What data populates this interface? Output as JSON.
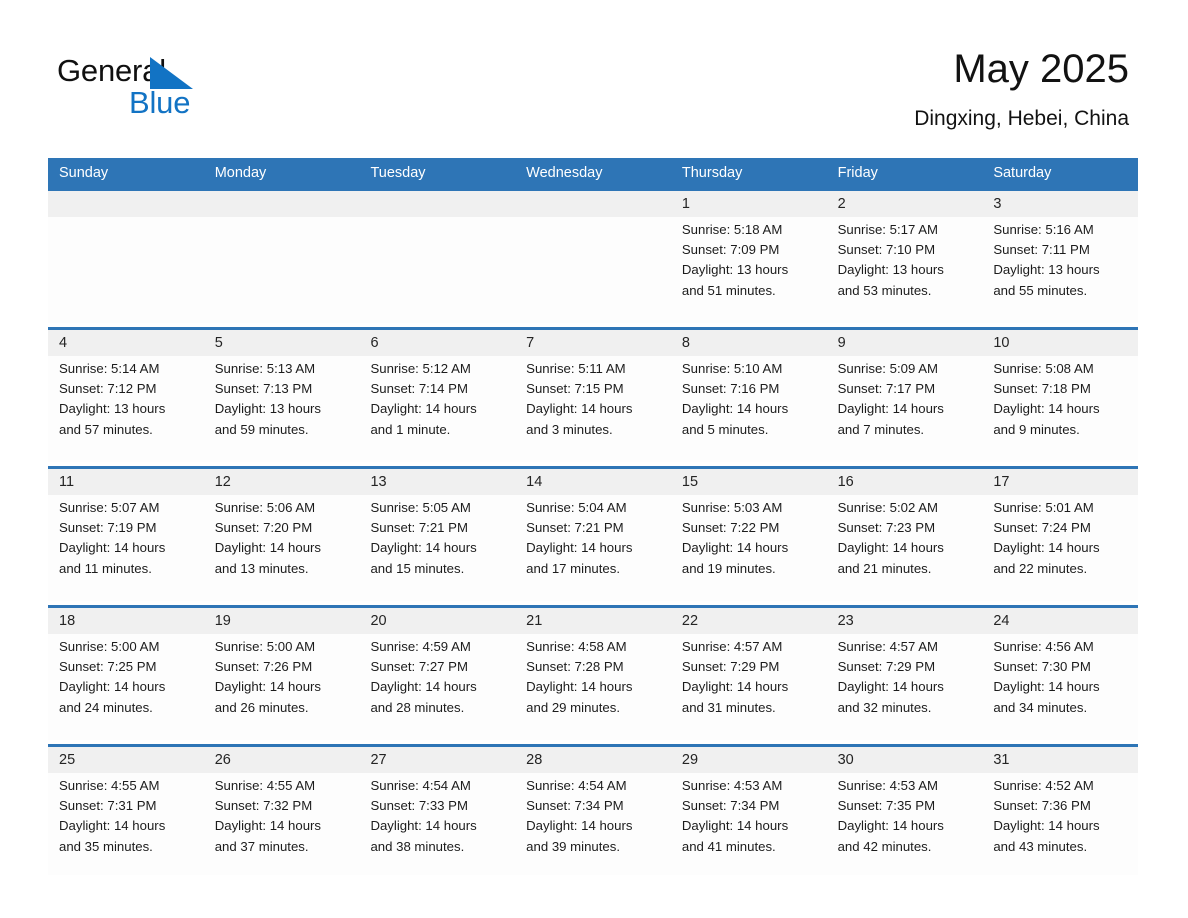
{
  "brand": {
    "name_part1": "General",
    "name_part2": "Blue",
    "triangle_color": "#1273c4",
    "text_color": "#101010"
  },
  "header": {
    "title": "May 2025",
    "subtitle": "Dingxing, Hebei, China"
  },
  "colors": {
    "header_blue": "#2e75b6",
    "date_band_gray": "#f0f0f0",
    "cell_white": "#fdfdfd",
    "text": "#1c1c1c"
  },
  "weekday_headers": [
    "Sunday",
    "Monday",
    "Tuesday",
    "Wednesday",
    "Thursday",
    "Friday",
    "Saturday"
  ],
  "weeks": [
    {
      "days": [
        {
          "num": "",
          "sunrise": "",
          "sunset": "",
          "daylight1": "",
          "daylight2": ""
        },
        {
          "num": "",
          "sunrise": "",
          "sunset": "",
          "daylight1": "",
          "daylight2": ""
        },
        {
          "num": "",
          "sunrise": "",
          "sunset": "",
          "daylight1": "",
          "daylight2": ""
        },
        {
          "num": "",
          "sunrise": "",
          "sunset": "",
          "daylight1": "",
          "daylight2": ""
        },
        {
          "num": "1",
          "sunrise": "Sunrise: 5:18 AM",
          "sunset": "Sunset: 7:09 PM",
          "daylight1": "Daylight: 13 hours",
          "daylight2": "and 51 minutes."
        },
        {
          "num": "2",
          "sunrise": "Sunrise: 5:17 AM",
          "sunset": "Sunset: 7:10 PM",
          "daylight1": "Daylight: 13 hours",
          "daylight2": "and 53 minutes."
        },
        {
          "num": "3",
          "sunrise": "Sunrise: 5:16 AM",
          "sunset": "Sunset: 7:11 PM",
          "daylight1": "Daylight: 13 hours",
          "daylight2": "and 55 minutes."
        }
      ]
    },
    {
      "days": [
        {
          "num": "4",
          "sunrise": "Sunrise: 5:14 AM",
          "sunset": "Sunset: 7:12 PM",
          "daylight1": "Daylight: 13 hours",
          "daylight2": "and 57 minutes."
        },
        {
          "num": "5",
          "sunrise": "Sunrise: 5:13 AM",
          "sunset": "Sunset: 7:13 PM",
          "daylight1": "Daylight: 13 hours",
          "daylight2": "and 59 minutes."
        },
        {
          "num": "6",
          "sunrise": "Sunrise: 5:12 AM",
          "sunset": "Sunset: 7:14 PM",
          "daylight1": "Daylight: 14 hours",
          "daylight2": "and 1 minute."
        },
        {
          "num": "7",
          "sunrise": "Sunrise: 5:11 AM",
          "sunset": "Sunset: 7:15 PM",
          "daylight1": "Daylight: 14 hours",
          "daylight2": "and 3 minutes."
        },
        {
          "num": "8",
          "sunrise": "Sunrise: 5:10 AM",
          "sunset": "Sunset: 7:16 PM",
          "daylight1": "Daylight: 14 hours",
          "daylight2": "and 5 minutes."
        },
        {
          "num": "9",
          "sunrise": "Sunrise: 5:09 AM",
          "sunset": "Sunset: 7:17 PM",
          "daylight1": "Daylight: 14 hours",
          "daylight2": "and 7 minutes."
        },
        {
          "num": "10",
          "sunrise": "Sunrise: 5:08 AM",
          "sunset": "Sunset: 7:18 PM",
          "daylight1": "Daylight: 14 hours",
          "daylight2": "and 9 minutes."
        }
      ]
    },
    {
      "days": [
        {
          "num": "11",
          "sunrise": "Sunrise: 5:07 AM",
          "sunset": "Sunset: 7:19 PM",
          "daylight1": "Daylight: 14 hours",
          "daylight2": "and 11 minutes."
        },
        {
          "num": "12",
          "sunrise": "Sunrise: 5:06 AM",
          "sunset": "Sunset: 7:20 PM",
          "daylight1": "Daylight: 14 hours",
          "daylight2": "and 13 minutes."
        },
        {
          "num": "13",
          "sunrise": "Sunrise: 5:05 AM",
          "sunset": "Sunset: 7:21 PM",
          "daylight1": "Daylight: 14 hours",
          "daylight2": "and 15 minutes."
        },
        {
          "num": "14",
          "sunrise": "Sunrise: 5:04 AM",
          "sunset": "Sunset: 7:21 PM",
          "daylight1": "Daylight: 14 hours",
          "daylight2": "and 17 minutes."
        },
        {
          "num": "15",
          "sunrise": "Sunrise: 5:03 AM",
          "sunset": "Sunset: 7:22 PM",
          "daylight1": "Daylight: 14 hours",
          "daylight2": "and 19 minutes."
        },
        {
          "num": "16",
          "sunrise": "Sunrise: 5:02 AM",
          "sunset": "Sunset: 7:23 PM",
          "daylight1": "Daylight: 14 hours",
          "daylight2": "and 21 minutes."
        },
        {
          "num": "17",
          "sunrise": "Sunrise: 5:01 AM",
          "sunset": "Sunset: 7:24 PM",
          "daylight1": "Daylight: 14 hours",
          "daylight2": "and 22 minutes."
        }
      ]
    },
    {
      "days": [
        {
          "num": "18",
          "sunrise": "Sunrise: 5:00 AM",
          "sunset": "Sunset: 7:25 PM",
          "daylight1": "Daylight: 14 hours",
          "daylight2": "and 24 minutes."
        },
        {
          "num": "19",
          "sunrise": "Sunrise: 5:00 AM",
          "sunset": "Sunset: 7:26 PM",
          "daylight1": "Daylight: 14 hours",
          "daylight2": "and 26 minutes."
        },
        {
          "num": "20",
          "sunrise": "Sunrise: 4:59 AM",
          "sunset": "Sunset: 7:27 PM",
          "daylight1": "Daylight: 14 hours",
          "daylight2": "and 28 minutes."
        },
        {
          "num": "21",
          "sunrise": "Sunrise: 4:58 AM",
          "sunset": "Sunset: 7:28 PM",
          "daylight1": "Daylight: 14 hours",
          "daylight2": "and 29 minutes."
        },
        {
          "num": "22",
          "sunrise": "Sunrise: 4:57 AM",
          "sunset": "Sunset: 7:29 PM",
          "daylight1": "Daylight: 14 hours",
          "daylight2": "and 31 minutes."
        },
        {
          "num": "23",
          "sunrise": "Sunrise: 4:57 AM",
          "sunset": "Sunset: 7:29 PM",
          "daylight1": "Daylight: 14 hours",
          "daylight2": "and 32 minutes."
        },
        {
          "num": "24",
          "sunrise": "Sunrise: 4:56 AM",
          "sunset": "Sunset: 7:30 PM",
          "daylight1": "Daylight: 14 hours",
          "daylight2": "and 34 minutes."
        }
      ]
    },
    {
      "days": [
        {
          "num": "25",
          "sunrise": "Sunrise: 4:55 AM",
          "sunset": "Sunset: 7:31 PM",
          "daylight1": "Daylight: 14 hours",
          "daylight2": "and 35 minutes."
        },
        {
          "num": "26",
          "sunrise": "Sunrise: 4:55 AM",
          "sunset": "Sunset: 7:32 PM",
          "daylight1": "Daylight: 14 hours",
          "daylight2": "and 37 minutes."
        },
        {
          "num": "27",
          "sunrise": "Sunrise: 4:54 AM",
          "sunset": "Sunset: 7:33 PM",
          "daylight1": "Daylight: 14 hours",
          "daylight2": "and 38 minutes."
        },
        {
          "num": "28",
          "sunrise": "Sunrise: 4:54 AM",
          "sunset": "Sunset: 7:34 PM",
          "daylight1": "Daylight: 14 hours",
          "daylight2": "and 39 minutes."
        },
        {
          "num": "29",
          "sunrise": "Sunrise: 4:53 AM",
          "sunset": "Sunset: 7:34 PM",
          "daylight1": "Daylight: 14 hours",
          "daylight2": "and 41 minutes."
        },
        {
          "num": "30",
          "sunrise": "Sunrise: 4:53 AM",
          "sunset": "Sunset: 7:35 PM",
          "daylight1": "Daylight: 14 hours",
          "daylight2": "and 42 minutes."
        },
        {
          "num": "31",
          "sunrise": "Sunrise: 4:52 AM",
          "sunset": "Sunset: 7:36 PM",
          "daylight1": "Daylight: 14 hours",
          "daylight2": "and 43 minutes."
        }
      ]
    }
  ]
}
